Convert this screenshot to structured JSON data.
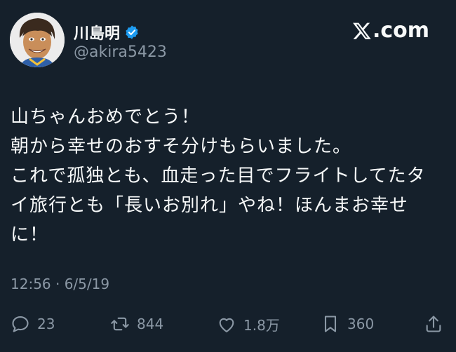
{
  "author": {
    "name": "川島明",
    "handle": "@akira5423",
    "verified": true,
    "avatar": "avatar-illustration"
  },
  "brand": {
    "logo_text": ".com",
    "logo_icon": "x-logo-icon"
  },
  "tweet": {
    "text": "山ちゃんおめでとう！\n朝から幸せのおすそ分けもらいました。\nこれで孤独とも、血走った目でフライトしてたタ\nイ旅行とも「長いお別れ」やね！ほんまお幸せ\nに！"
  },
  "meta": {
    "timestamp": "12:56 · 6/5/19"
  },
  "actions": {
    "reply": {
      "icon": "reply-icon",
      "count": "23"
    },
    "retweet": {
      "icon": "retweet-icon",
      "count": "844"
    },
    "like": {
      "icon": "heart-icon",
      "count": "1.8万"
    },
    "bookmark": {
      "icon": "bookmark-icon",
      "count": "360"
    },
    "share": {
      "icon": "share-icon"
    }
  },
  "colors": {
    "background": "#15202b",
    "text": "#f7f9f9",
    "secondary": "#8b98a5",
    "verified": "#1d9bf0"
  }
}
